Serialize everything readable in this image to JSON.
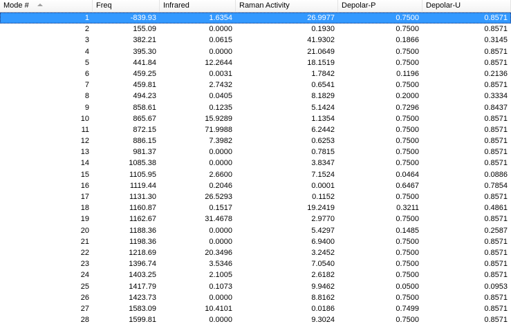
{
  "columns": [
    "Mode #",
    "Freq",
    "Infrared",
    "Raman Activity",
    "Depolar-P",
    "Depolar-U"
  ],
  "selected_row": 0,
  "rows": [
    [
      "1",
      "-839.93",
      "1.6354",
      "26.9977",
      "0.7500",
      "0.8571"
    ],
    [
      "2",
      "155.09",
      "0.0000",
      "0.1930",
      "0.7500",
      "0.8571"
    ],
    [
      "3",
      "382.21",
      "0.0615",
      "41.9302",
      "0.1866",
      "0.3145"
    ],
    [
      "4",
      "395.30",
      "0.0000",
      "21.0649",
      "0.7500",
      "0.8571"
    ],
    [
      "5",
      "441.84",
      "12.2644",
      "18.1519",
      "0.7500",
      "0.8571"
    ],
    [
      "6",
      "459.25",
      "0.0031",
      "1.7842",
      "0.1196",
      "0.2136"
    ],
    [
      "7",
      "459.81",
      "2.7432",
      "0.6541",
      "0.7500",
      "0.8571"
    ],
    [
      "8",
      "494.23",
      "0.0405",
      "8.1829",
      "0.2000",
      "0.3334"
    ],
    [
      "9",
      "858.61",
      "0.1235",
      "5.1424",
      "0.7296",
      "0.8437"
    ],
    [
      "10",
      "865.67",
      "15.9289",
      "1.1354",
      "0.7500",
      "0.8571"
    ],
    [
      "11",
      "872.15",
      "71.9988",
      "6.2442",
      "0.7500",
      "0.8571"
    ],
    [
      "12",
      "886.15",
      "7.3982",
      "0.6253",
      "0.7500",
      "0.8571"
    ],
    [
      "13",
      "981.37",
      "0.0000",
      "0.7815",
      "0.7500",
      "0.8571"
    ],
    [
      "14",
      "1085.38",
      "0.0000",
      "3.8347",
      "0.7500",
      "0.8571"
    ],
    [
      "15",
      "1105.95",
      "2.6600",
      "7.1524",
      "0.0464",
      "0.0886"
    ],
    [
      "16",
      "1119.44",
      "0.2046",
      "0.0001",
      "0.6467",
      "0.7854"
    ],
    [
      "17",
      "1131.30",
      "26.5293",
      "0.1152",
      "0.7500",
      "0.8571"
    ],
    [
      "18",
      "1160.87",
      "0.1517",
      "19.2419",
      "0.3211",
      "0.4861"
    ],
    [
      "19",
      "1162.67",
      "31.4678",
      "2.9770",
      "0.7500",
      "0.8571"
    ],
    [
      "20",
      "1188.36",
      "0.0000",
      "5.4297",
      "0.1485",
      "0.2587"
    ],
    [
      "21",
      "1198.36",
      "0.0000",
      "6.9400",
      "0.7500",
      "0.8571"
    ],
    [
      "22",
      "1218.69",
      "20.3496",
      "3.2452",
      "0.7500",
      "0.8571"
    ],
    [
      "23",
      "1396.74",
      "3.5346",
      "7.0540",
      "0.7500",
      "0.8571"
    ],
    [
      "24",
      "1403.25",
      "2.1005",
      "2.6182",
      "0.7500",
      "0.8571"
    ],
    [
      "25",
      "1417.79",
      "0.1073",
      "9.9462",
      "0.0500",
      "0.0953"
    ],
    [
      "26",
      "1423.73",
      "0.0000",
      "8.8162",
      "0.7500",
      "0.8571"
    ],
    [
      "27",
      "1583.09",
      "10.4101",
      "0.0186",
      "0.7499",
      "0.8571"
    ],
    [
      "28",
      "1599.81",
      "0.0000",
      "9.3024",
      "0.7500",
      "0.8571"
    ]
  ]
}
